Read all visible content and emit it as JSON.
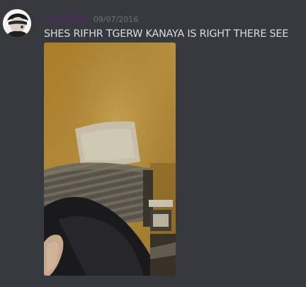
{
  "message": {
    "author": {
      "name": "sea hitler",
      "name_color": "#5b1f6e",
      "avatar_icon": "avatar-icon"
    },
    "timestamp": "09/07/2016",
    "text": "SHES RIFHR TGERW KANAYA IS RIGHT THERE SEE",
    "attachment": {
      "type": "image",
      "description_icon": "photo-attachment"
    }
  },
  "theme": {
    "background": "#36393e",
    "text_color": "#dcddde",
    "timestamp_color": "#6f7379"
  }
}
